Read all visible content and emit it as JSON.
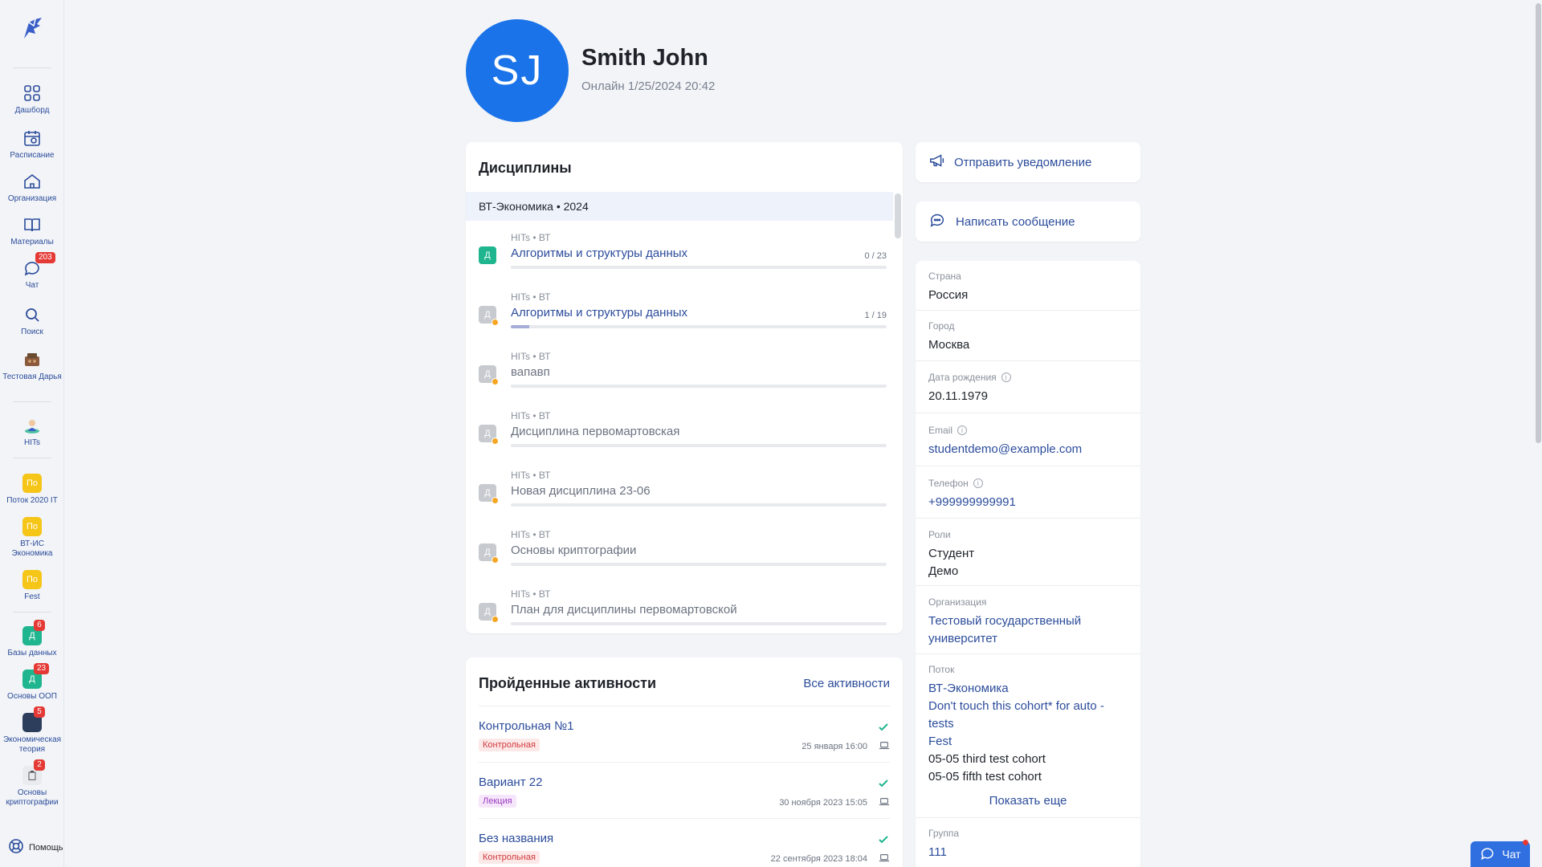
{
  "sidebar": {
    "items": [
      {
        "label": "Дашборд",
        "icon": "dashboard-icon"
      },
      {
        "label": "Расписание",
        "icon": "calendar-icon"
      },
      {
        "label": "Организация",
        "icon": "home-icon"
      },
      {
        "label": "Материалы",
        "icon": "book-icon"
      },
      {
        "label": "Чат",
        "icon": "chat-icon",
        "badge": "203"
      },
      {
        "label": "Поиск",
        "icon": "search-icon"
      },
      {
        "label": "Тестовая Дарья",
        "icon": "org-image-icon"
      },
      {
        "label": "HITs",
        "icon": "hits-image-icon"
      }
    ],
    "cohorts": [
      {
        "label": "Поток 2020 IT",
        "abbr": "По"
      },
      {
        "label": "ВТ-ИС Экономика",
        "abbr": "По"
      },
      {
        "label": "Fest",
        "abbr": "По"
      }
    ],
    "courses": [
      {
        "label": "Базы данных",
        "abbr": "Д",
        "badge": "6"
      },
      {
        "label": "Основы ООП",
        "abbr": "Д",
        "badge": "23"
      },
      {
        "label": "Экономическая теория",
        "badge": "5"
      },
      {
        "label": "Основы криптографии",
        "badge": "2"
      }
    ],
    "help": "Помощь"
  },
  "profile": {
    "initials": "SJ",
    "name": "Smith John",
    "status": "Онлайн 1/25/2024 20:42"
  },
  "disciplines": {
    "title": "Дисциплины",
    "cohort": "ВТ-Экономика • 2024",
    "items": [
      {
        "meta": "HITs • ВТ",
        "title": "Алгоритмы и структуры данных",
        "count": "0 / 23",
        "progress": 0,
        "active": true
      },
      {
        "meta": "HITs • ВТ",
        "title": "Алгоритмы и структуры данных",
        "count": "1 / 19",
        "progress": 0.05,
        "active": true
      },
      {
        "meta": "HITs • ВТ",
        "title": "вапавп",
        "count": "",
        "progress": 0,
        "active": false
      },
      {
        "meta": "HITs • ВТ",
        "title": "Дисциплина первомартовская",
        "count": "",
        "progress": 0,
        "active": false
      },
      {
        "meta": "HITs • ВТ",
        "title": "Новая дисциплина 23-06",
        "count": "",
        "progress": 0,
        "active": false
      },
      {
        "meta": "HITs • ВТ",
        "title": "Основы криптографии",
        "count": "",
        "progress": 0,
        "active": false
      },
      {
        "meta": "HITs • ВТ",
        "title": "План для дисциплины первомартовской",
        "count": "",
        "progress": 0,
        "active": false
      }
    ],
    "icon_letter": "Д"
  },
  "activities": {
    "title": "Пройденные активности",
    "all_link": "Все активности",
    "items": [
      {
        "title": "Контрольная №1",
        "tag": "Контрольная",
        "tag_type": "test",
        "date": "25 января 16:00"
      },
      {
        "title": "Вариант 22",
        "tag": "Лекция",
        "tag_type": "lecture",
        "date": "30 ноября 2023 15:05"
      },
      {
        "title": "Без названия",
        "tag": "Контрольная",
        "tag_type": "test",
        "date": "22 сентября 2023 18:04"
      }
    ]
  },
  "actions": {
    "notify": "Отправить уведомление",
    "message": "Написать сообщение"
  },
  "info": {
    "country_label": "Страна",
    "country": "Россия",
    "city_label": "Город",
    "city": "Москва",
    "birth_label": "Дата рождения",
    "birth": "20.11.1979",
    "email_label": "Email",
    "email": "studentdemo@example.com",
    "phone_label": "Телефон",
    "phone": "+999999999991",
    "roles_label": "Роли",
    "role1": "Студент",
    "role2": "Демо",
    "org_label": "Организация",
    "org": "Тестовый государственный университет",
    "cohort_label": "Поток",
    "cohorts": [
      "ВТ-Экономика",
      "Don't touch this cohort* for auto - tests",
      "Fest",
      "05-05 third test cohort",
      "05-05 fifth test cohort"
    ],
    "show_more": "Показать еще",
    "group_label": "Группа",
    "group": "111"
  },
  "chat_button": "Чат",
  "colors": {
    "accent": "#2b4c9b",
    "avatar": "#1a73e8",
    "badge": "#e53935",
    "green": "#1fb58f",
    "yellow": "#f5c518"
  }
}
